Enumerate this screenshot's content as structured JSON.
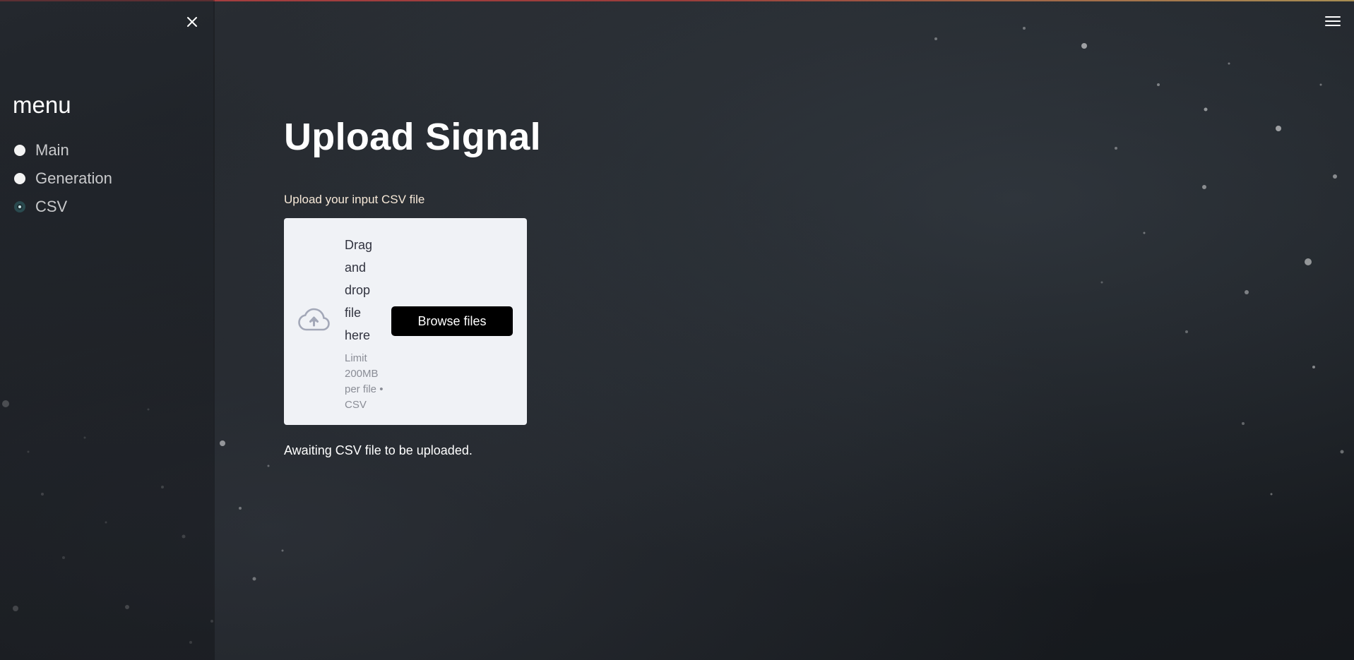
{
  "sidebar": {
    "close_icon": "close-icon",
    "title": "menu",
    "radio": {
      "options": [
        "Main",
        "Generation",
        "CSV"
      ],
      "selected": "CSV"
    }
  },
  "header": {
    "menu_icon": "hamburger-menu-icon"
  },
  "main": {
    "title": "Upload Signal",
    "uploader": {
      "label": "Upload your input CSV file",
      "icon": "cloud-upload-icon",
      "drag_text": "Drag and drop file here",
      "limit_text": "Limit 200MB per file • CSV",
      "browse_label": "Browse files"
    },
    "status": "Awaiting CSV file to be uploaded."
  },
  "colors": {
    "dropzone_bg": "#f0f2f6",
    "button_bg": "#000000",
    "label_color": "#f7e9d8",
    "accent_line": "#ff4b4b"
  }
}
